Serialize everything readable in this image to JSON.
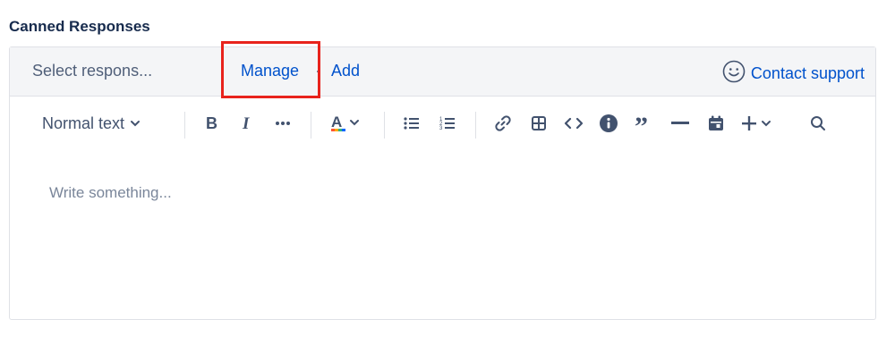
{
  "section": {
    "title": "Canned Responses"
  },
  "topbar": {
    "select_placeholder": "Select respons...",
    "manage_label": "Manage",
    "separator": "·",
    "add_label": "Add",
    "contact_support_label": "Contact support",
    "contact_support_icon": "smiley-icon"
  },
  "toolbar": {
    "text_style": "Normal text",
    "buttons": [
      "bold-icon",
      "italic-icon",
      "more-formatting-icon",
      "text-color-icon",
      "bullet-list-icon",
      "numbered-list-icon",
      "link-icon",
      "table-icon",
      "code-icon",
      "info-panel-icon",
      "quote-icon",
      "divider-icon",
      "date-icon",
      "insert-plus-icon",
      "search-icon"
    ]
  },
  "editor": {
    "placeholder": "Write something..."
  },
  "colors": {
    "link": "#0052cc",
    "highlight_box": "#e8231c",
    "topbar_bg": "#f4f5f7",
    "icon": "#42526e"
  }
}
